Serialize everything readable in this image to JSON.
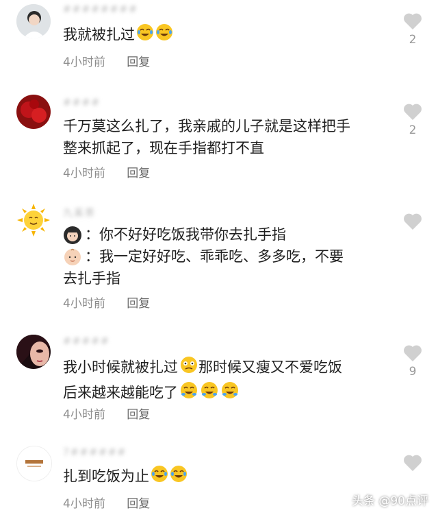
{
  "comments": [
    {
      "username": "########",
      "lines": [
        "我就被扎过"
      ],
      "time": "4小时前",
      "reply": "回复",
      "likes": "2"
    },
    {
      "username": "####",
      "lines": [
        "千万莫这么扎了，我亲戚的儿子就是这样把手",
        "整来抓起了，现在手指都打不直"
      ],
      "time": "4小时前",
      "reply": "回复",
      "likes": "2"
    },
    {
      "username": "九奚荼",
      "lines": [
        "：你不好好吃饭我带你去扎手指",
        "：我一定好好吃、乖乖吃、多多吃，不要",
        "去扎手指"
      ],
      "time": "4小时前",
      "reply": "回复",
      "likes": ""
    },
    {
      "username": "#####",
      "lines": [
        "我小时候就被扎过",
        "那时候又瘦又不爱吃饭",
        "后来越来越能吃了"
      ],
      "time": "4小时前",
      "reply": "回复",
      "likes": "9"
    },
    {
      "username": "7######",
      "lines": [
        "扎到吃饭为止"
      ],
      "time": "4小时前",
      "reply": "回复",
      "likes": ""
    }
  ],
  "watermark": "头条 @90点评",
  "colors": {
    "heart": "#d0d0d0",
    "meta": "#8d8d8d",
    "text": "#1f1f1f"
  }
}
